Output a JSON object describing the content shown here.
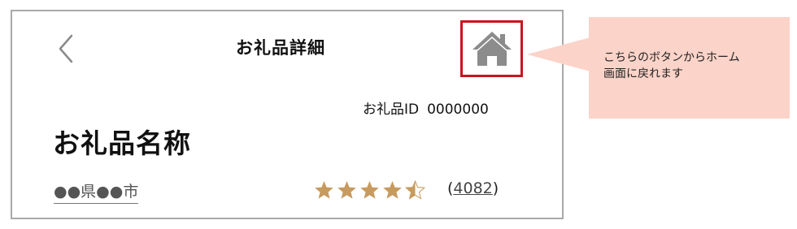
{
  "header": {
    "title": "お礼品詳細",
    "back_icon": "chevron-left-icon",
    "home_icon": "home-icon"
  },
  "gift": {
    "id_label": "お礼品ID",
    "id_value": "0000000",
    "name": "お礼品名称",
    "location": "●●県●●市"
  },
  "rating": {
    "score": 4.5,
    "max": 5,
    "star_color": "#c79a5e",
    "review_open": "(",
    "review_count": "4082",
    "review_close": ")"
  },
  "callout": {
    "text_line1": "こちらのボタンからホーム",
    "text_line2": "画面に戻れます",
    "background": "#fbd3c8",
    "highlight_color": "#c9151e"
  }
}
